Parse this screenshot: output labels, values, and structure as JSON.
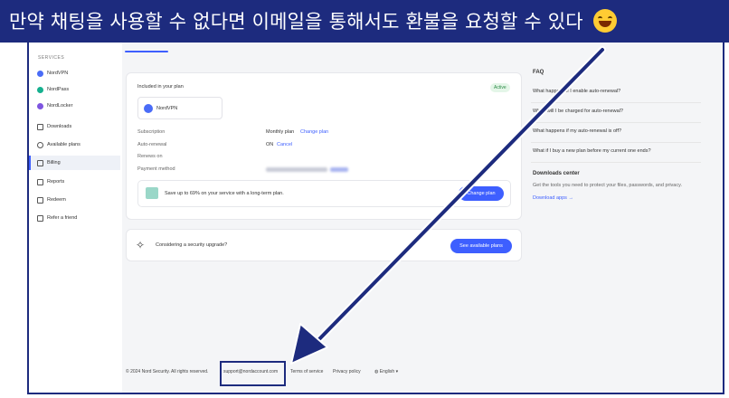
{
  "banner": {
    "text": "만약 채팅을 사용할 수 없다면 이메일을 통해서도 환불을 요청할 수 있다"
  },
  "sidebar": {
    "section_label": "SERVICES",
    "items": [
      {
        "label": "NordVPN",
        "icon": "nordvpn-icon",
        "color": "#4a6cf7"
      },
      {
        "label": "NordPass",
        "icon": "nordpass-icon",
        "color": "#16b08f"
      },
      {
        "label": "NordLocker",
        "icon": "nordlocker-icon",
        "color": "#7e55e0"
      },
      {
        "label": "Downloads",
        "icon": "download-icon"
      },
      {
        "label": "Available plans",
        "icon": "plans-icon"
      },
      {
        "label": "Billing",
        "icon": "billing-icon",
        "active": true
      },
      {
        "label": "Reports",
        "icon": "reports-icon"
      },
      {
        "label": "Redeem",
        "icon": "redeem-icon"
      },
      {
        "label": "Refer a friend",
        "icon": "gift-icon"
      }
    ]
  },
  "plan_card": {
    "heading": "Included in your plan",
    "status": "Active",
    "product": "NordVPN",
    "rows": {
      "subscription_label": "Subscription",
      "subscription_value": "Monthly plan",
      "change_plan_link": "Change plan",
      "autorenew_label": "Auto-renewal",
      "autorenew_value": "ON",
      "cancel_link": "Cancel",
      "renews_label": "Renews on",
      "payment_label": "Payment method"
    },
    "promo_text": "Save up to 69% on your service with a long-term plan.",
    "promo_button": "Change plan"
  },
  "security_card": {
    "text": "Considering a security upgrade?",
    "button": "See available plans"
  },
  "faq": {
    "title": "FAQ",
    "items": [
      "What happens if I enable auto-renewal?",
      "When will I be charged for auto-renewal?",
      "What happens if my auto-renewal is off?",
      "What if I buy a new plan before my current one ends?"
    ]
  },
  "downloads": {
    "title": "Downloads center",
    "text": "Get the tools you need to protect your files, passwords, and privacy.",
    "link": "Download apps"
  },
  "footer": {
    "copyright": "© 2024 Nord Security. All rights reserved.",
    "email": "support@nordaccount.com",
    "terms": "Terms of service",
    "privacy": "Privacy policy",
    "language": "English"
  },
  "colors": {
    "banner": "#1d2b7e",
    "accent": "#3e5fff",
    "active_badge": "#2a8a45"
  }
}
